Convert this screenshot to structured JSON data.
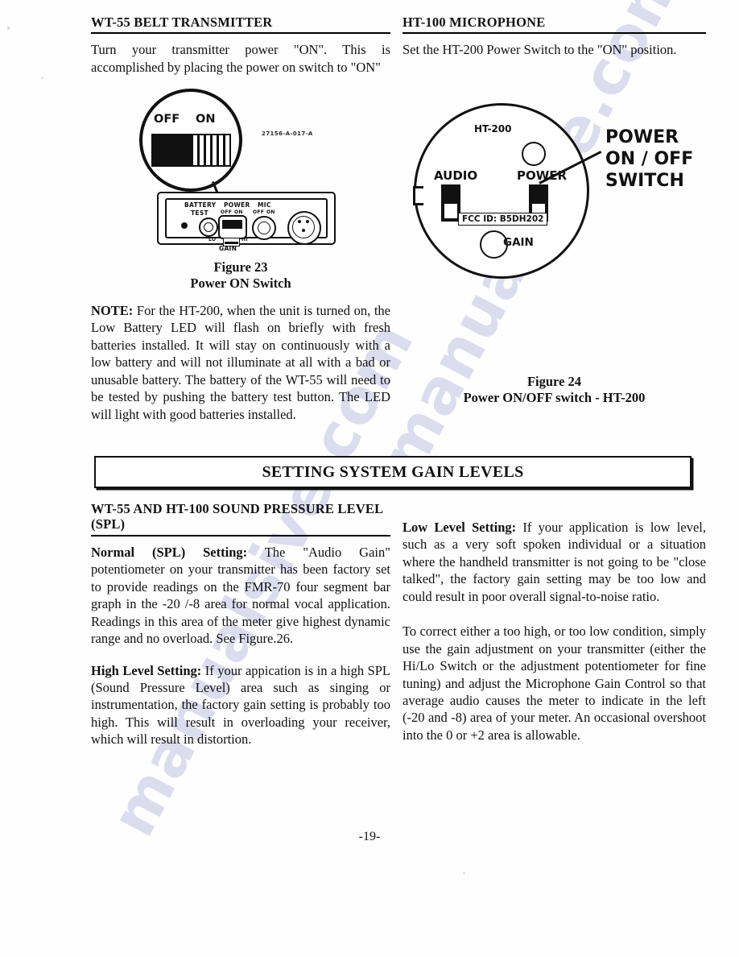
{
  "page": {
    "number": "-19-"
  },
  "left_column": {
    "heading": "WT-55 BELT TRANSMITTER",
    "intro": "Turn your transmitter power \"ON\". This is accomplished by placing the power on switch to \"ON\"",
    "note_label": "NOTE:",
    "note_text": " For the HT-200, when the unit is turned on, the Low Battery LED will flash on briefly with fresh batteries installed. It will stay on continuously with a low battery and will not illuminate at all with a bad or unusable battery. The battery of the WT-55 will need to be tested by pushing the battery test button. The LED will light with good batteries installed."
  },
  "right_column": {
    "heading": "HT-100 MICROPHONE",
    "intro": "Set the HT-200 Power Switch to the \"ON\" position."
  },
  "figure_23": {
    "caption_line1": "Figure 23",
    "caption_line2": "Power ON Switch",
    "magnifier": {
      "off_label": "OFF",
      "on_label": "ON"
    },
    "part_number": "27156-A-017-A",
    "panel_labels": {
      "battery": "BATTERY",
      "test": "TEST",
      "power": "POWER",
      "power_off": "OFF",
      "power_on": "ON",
      "mic": "MIC",
      "mic_off": "OFF",
      "mic_on": "ON",
      "lo": "LO",
      "hi": "HI",
      "gain": "GAIN"
    }
  },
  "figure_24": {
    "caption_line1": "Figure 24",
    "caption_line2": "Power ON/OFF switch - HT-200",
    "device_title": "HT-200",
    "audio_label": "AUDIO",
    "power_label": "POWER",
    "gain_label": "GAIN",
    "fcc_label": "FCC ID: B5DH202",
    "callout_line1": "POWER",
    "callout_line2": "ON / OFF",
    "callout_line3": "SWITCH"
  },
  "banner": {
    "title": "SETTING SYSTEM GAIN LEVELS"
  },
  "spl_section": {
    "heading": "WT-55 AND HT-100 SOUND PRESSURE LEVEL (SPL)",
    "normal_label": "Normal (SPL) Setting:",
    "normal_text": " The \"Audio Gain\" potentiometer on your transmitter has been factory set to provide readings on the FMR-70 four segment bar graph in the -20 /-8 area for normal vocal application. Readings in this area of the meter give highest dynamic range and no overload. See Figure.26.",
    "high_label": "High Level Setting:",
    "high_text": "  If your appication is in a high SPL (Sound Pressure Level) area such as singing or instrumentation, the factory gain setting is probably too high. This will result in overloading your receiver, which will result in distortion.",
    "low_label": "Low Level Setting:",
    "low_text": "  If your application is low level, such as a very soft spoken individual or a situation where the handheld transmitter is not going to be \"close talked\", the factory gain setting may be too low and could result in poor overall signal-to-noise ratio.",
    "correct_text": "To correct either a too high, or too low condition, simply use the gain adjustment on your transmitter (either the Hi/Lo Switch or the adjustment potentiometer for fine tuning) and adjust the Microphone Gain Control so that average audio causes the meter to indicate in the left (-20 and -8) area of your meter.  An occasional overshoot into the 0 or +2 area is allowable."
  },
  "watermark": {
    "text_1": "manualsive.com",
    "text_2": "manualsive.com"
  }
}
